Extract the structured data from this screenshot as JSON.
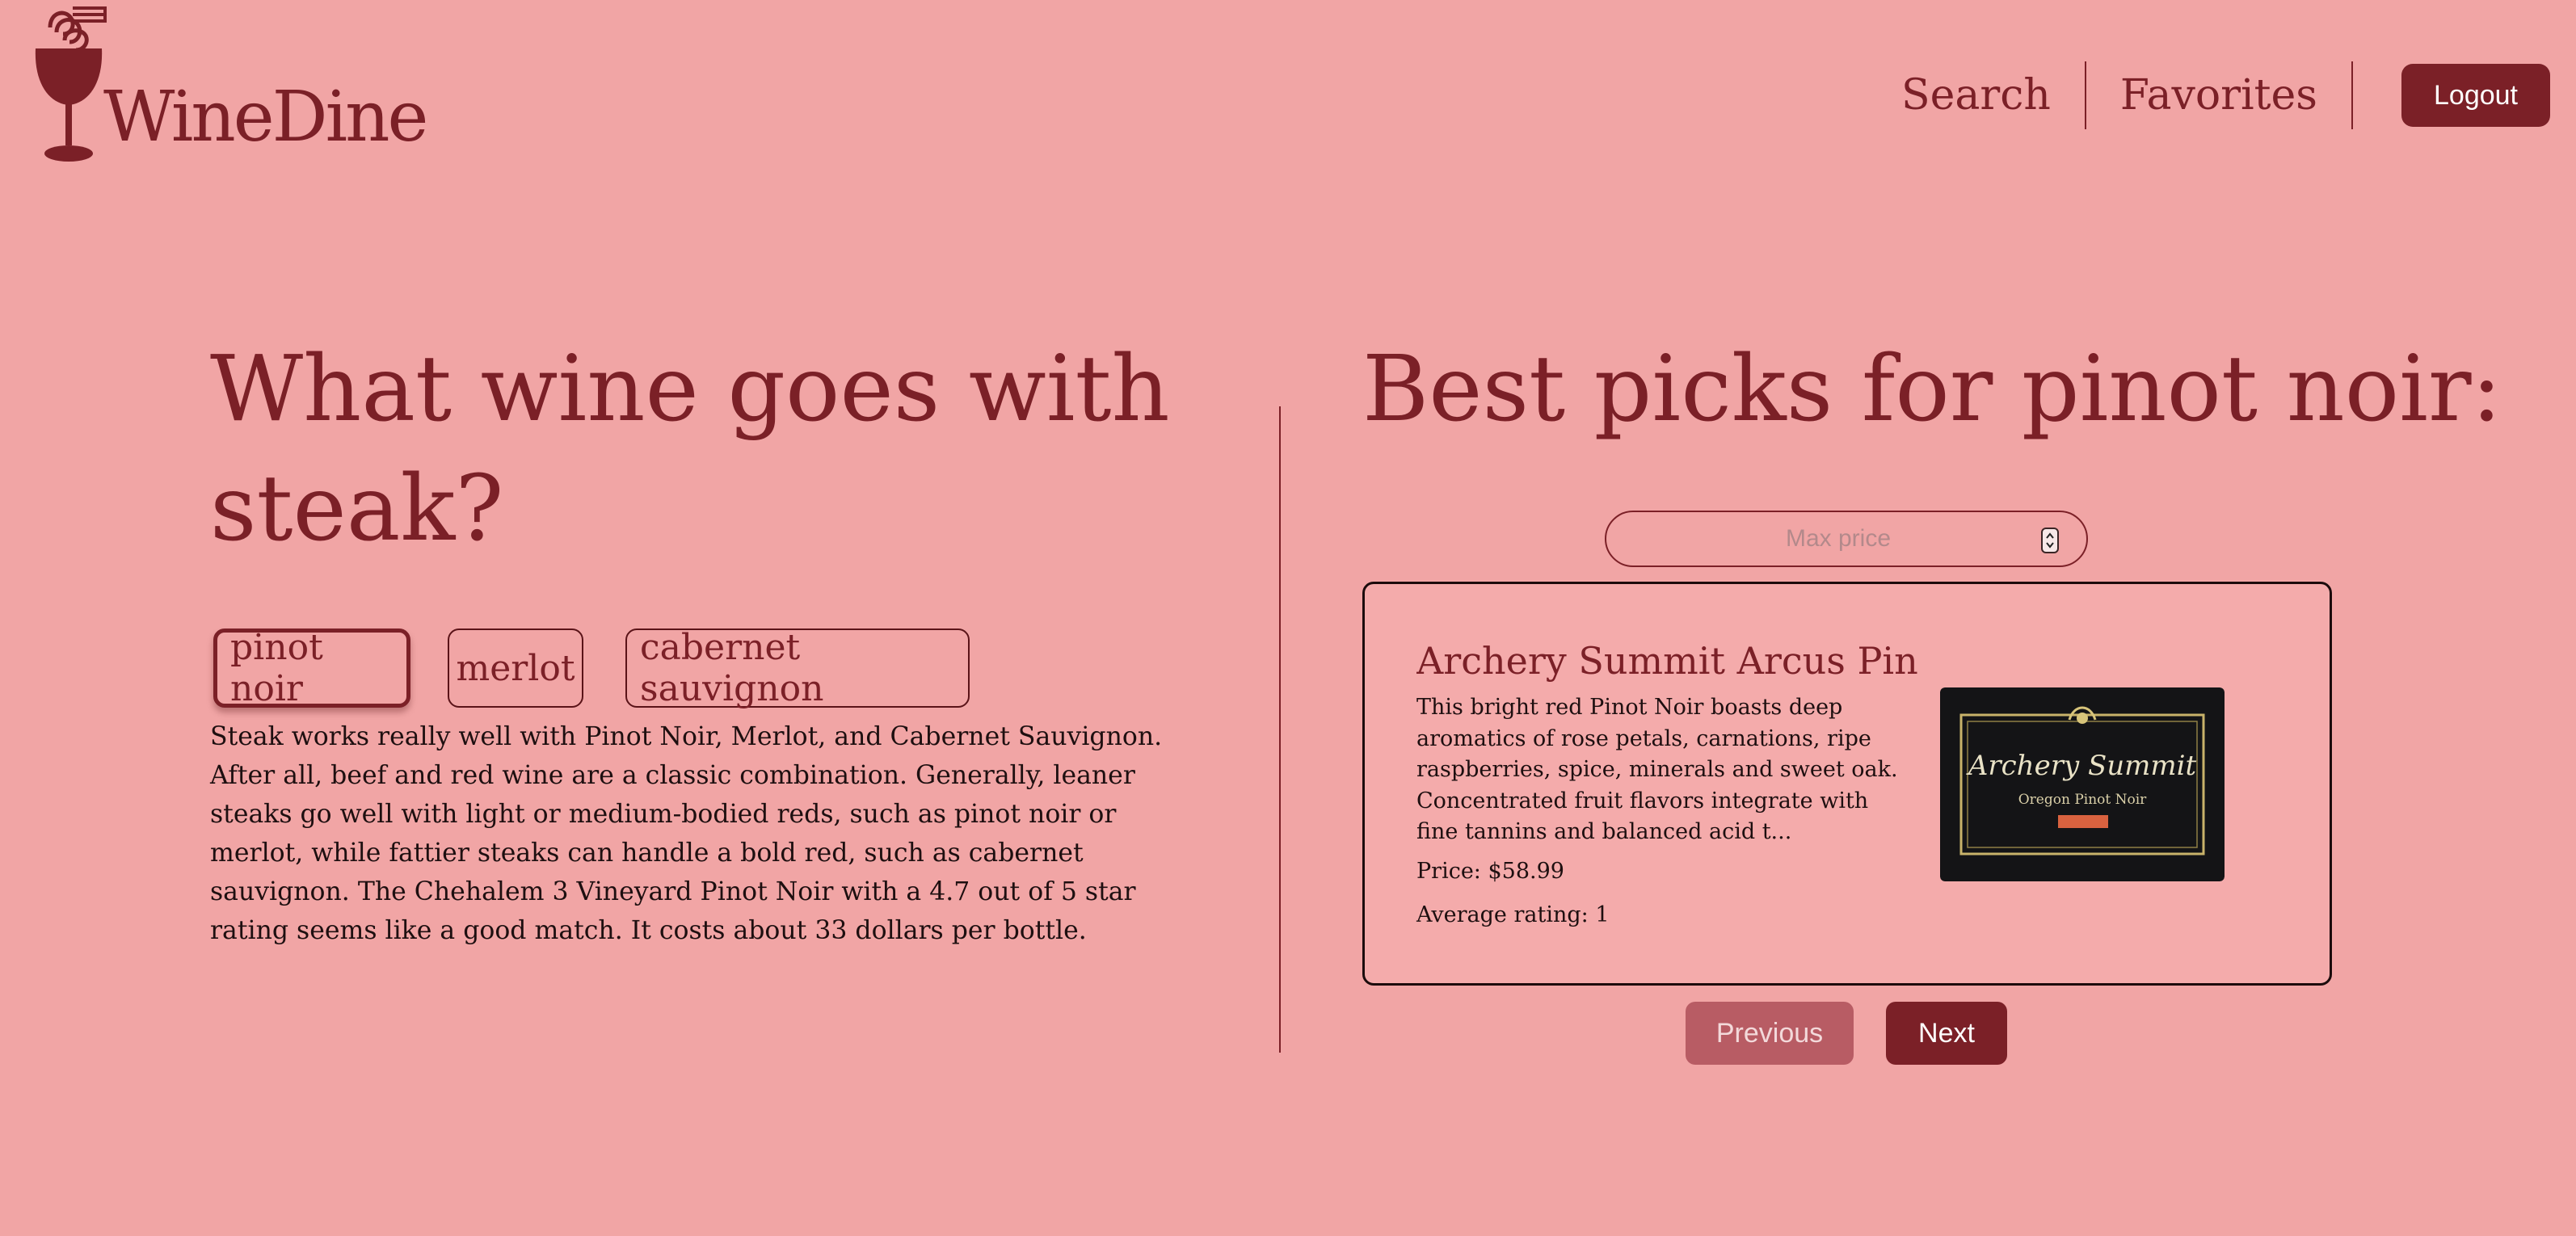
{
  "app": {
    "brand": "WineDine"
  },
  "nav": {
    "search": "Search",
    "favorites": "Favorites",
    "logout": "Logout"
  },
  "question": {
    "title": "What wine goes with steak?"
  },
  "wine_types": [
    {
      "label": "pinot noir",
      "selected": true
    },
    {
      "label": "merlot",
      "selected": false
    },
    {
      "label": "cabernet sauvignon",
      "selected": false
    }
  ],
  "explanation": "Steak works really well with Pinot Noir, Merlot, and Cabernet Sauvignon. After all, beef and red wine are a classic combination. Generally, leaner steaks go well with light or medium-bodied reds, such as pinot noir or merlot, while fattier steaks can handle a bold red, such as cabernet sauvignon. The Chehalem 3 Vineyard Pinot Noir with a 4.7 out of 5 star rating seems like a good match. It costs about 33 dollars per bottle.",
  "picks": {
    "title": "Best picks for pinot noir:",
    "max_price_placeholder": "Max price",
    "max_price_value": ""
  },
  "wine_card": {
    "name": "Archery Summit Arcus Pin...",
    "description": "This bright red Pinot Noir boasts deep aromatics of rose petals, carnations, ripe raspberries, spice, minerals and sweet oak. Concentrated fruit flavors integrate with fine tannins and balanced acid t...",
    "price": "Price: $58.99",
    "rating": "Average rating: 1",
    "label_image": {
      "brand_text": "Archery Summit",
      "sub_text": "Oregon Pinot Noir"
    }
  },
  "pagination": {
    "previous": "Previous",
    "next": "Next"
  },
  "colors": {
    "background": "#f1a5a5",
    "accent": "#7b2027",
    "previous_button": "#b85c64"
  }
}
